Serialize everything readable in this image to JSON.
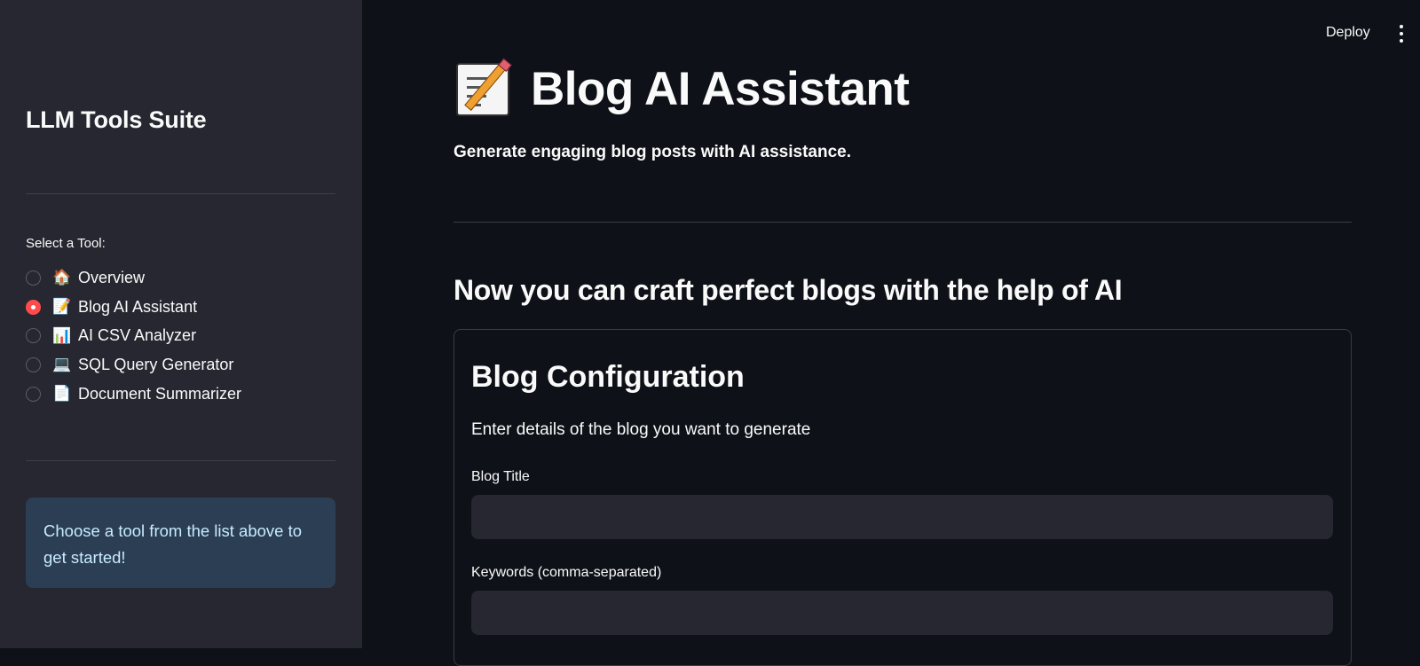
{
  "sidebar": {
    "title": "LLM Tools Suite",
    "select_label": "Select a Tool:",
    "tools": [
      {
        "icon": "🏠",
        "icon_name": "house-icon",
        "label": "Overview",
        "selected": false
      },
      {
        "icon": "📝",
        "icon_name": "memo-icon",
        "label": "Blog AI Assistant",
        "selected": true
      },
      {
        "icon": "📊",
        "icon_name": "bar-chart-icon",
        "label": "AI CSV Analyzer",
        "selected": false
      },
      {
        "icon": "💻",
        "icon_name": "laptop-icon",
        "label": "SQL Query Generator",
        "selected": false
      },
      {
        "icon": "📄",
        "icon_name": "document-icon",
        "label": "Document Summarizer",
        "selected": false
      }
    ],
    "info": "Choose a tool from the list above to get started!"
  },
  "header": {
    "deploy_label": "Deploy"
  },
  "main": {
    "title": "Blog AI Assistant",
    "title_icon": "memo-icon",
    "subtitle": "Generate engaging blog posts with AI assistance.",
    "heading": "Now you can craft perfect blogs with the help of AI",
    "config": {
      "title": "Blog Configuration",
      "description": "Enter details of the blog you want to generate",
      "blog_title_label": "Blog Title",
      "blog_title_value": "",
      "keywords_label": "Keywords (comma-separated)",
      "keywords_value": ""
    }
  },
  "colors": {
    "sidebar_bg": "#262730",
    "main_bg": "#0e1117",
    "accent": "#ff4b4b",
    "info_bg": "#2c3e54",
    "info_text": "#c7ebff"
  }
}
